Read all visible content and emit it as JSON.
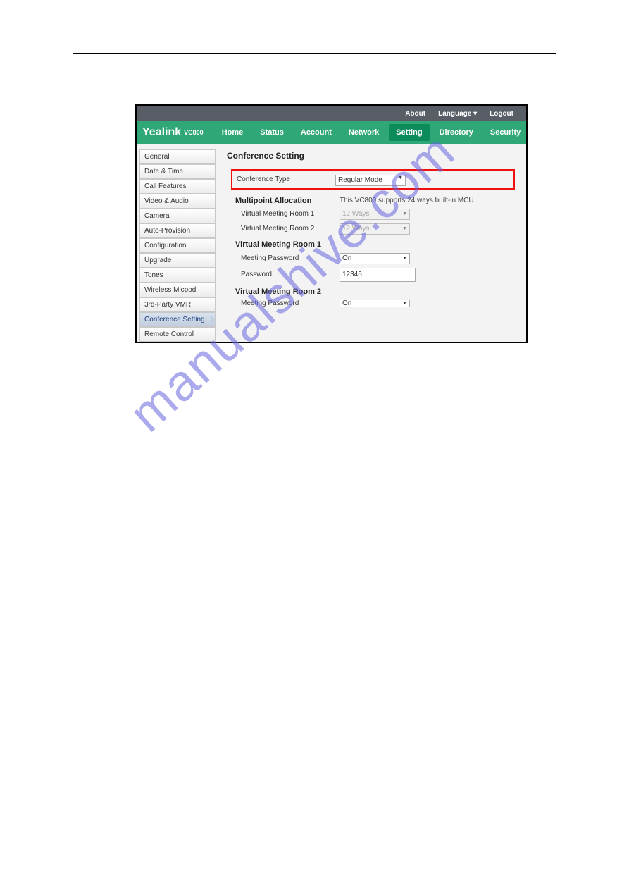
{
  "topbar": {
    "about": "About",
    "language": "Language ▾",
    "logout": "Logout"
  },
  "brand": {
    "name": "Yealink",
    "model": "VC800"
  },
  "nav": {
    "items": [
      "Home",
      "Status",
      "Account",
      "Network",
      "Setting",
      "Directory",
      "Security"
    ],
    "active": "Setting"
  },
  "sidebar": {
    "items": [
      "General",
      "Date & Time",
      "Call Features",
      "Video & Audio",
      "Camera",
      "Auto-Provision",
      "Configuration",
      "Upgrade",
      "Tones",
      "Wireless Micpod",
      "3rd-Party VMR",
      "Conference Setting",
      "Remote Control"
    ],
    "active": "Conference Setting"
  },
  "main": {
    "title": "Conference Setting",
    "conference_type_label": "Conference Type",
    "conference_type_value": "Regular Mode",
    "multipoint_header": "Multipoint Allocation",
    "multipoint_info": "This VC800 supports 24 ways built-in MCU",
    "vmr1_alloc_label": "Virtual Meeting Room 1",
    "vmr1_alloc_value": "12 Ways",
    "vmr2_alloc_label": "Virtual Meeting Room 2",
    "vmr2_alloc_value": "12 Ways",
    "vmr1_header": "Virtual Meeting Room 1",
    "vmr1_pwd_label": "Meeting Password",
    "vmr1_pwd_value": "On",
    "vmr1_password_label": "Password",
    "vmr1_password_value": "12345",
    "vmr2_header": "Virtual Meeting Room 2",
    "vmr2_pwd_label": "Meeting Password",
    "vmr2_pwd_value": "On"
  },
  "watermark": "manualshive.com"
}
